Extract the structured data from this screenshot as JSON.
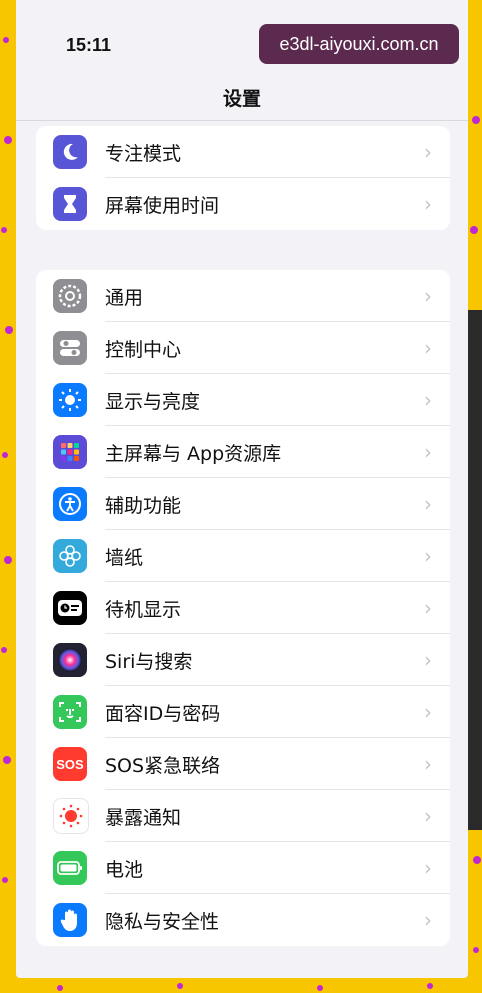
{
  "status_bar": {
    "time": "15:11"
  },
  "watermark": "e3dl-aiyouxi.com.cn",
  "nav": {
    "title": "设置"
  },
  "group1": [
    {
      "label": "专注模式",
      "icon": "moon-icon",
      "color": "#5856d6"
    },
    {
      "label": "屏幕使用时间",
      "icon": "hourglass-icon",
      "color": "#5856d6"
    }
  ],
  "group2": [
    {
      "label": "通用",
      "icon": "gear-icon",
      "color": "#8e8e93"
    },
    {
      "label": "控制中心",
      "icon": "toggles-icon",
      "color": "#8e8e93"
    },
    {
      "label": "显示与亮度",
      "icon": "sun-icon",
      "color": "#0a7aff"
    },
    {
      "label": "主屏幕与 App资源库",
      "icon": "apps-grid-icon",
      "color": "#5b4bd6"
    },
    {
      "label": "辅助功能",
      "icon": "accessibility-icon",
      "color": "#0a7aff"
    },
    {
      "label": "墙纸",
      "icon": "flower-icon",
      "color": "#34aadc"
    },
    {
      "label": "待机显示",
      "icon": "standby-icon",
      "color": "#000000"
    },
    {
      "label": "Siri与搜索",
      "icon": "siri-icon",
      "color": "#222233"
    },
    {
      "label": "面容ID与密码",
      "icon": "face-id-icon",
      "color": "#34c759"
    },
    {
      "label": "SOS紧急联络",
      "icon": "sos-icon",
      "color": "#ff3b30",
      "icon_text": "SOS"
    },
    {
      "label": "暴露通知",
      "icon": "exposure-icon",
      "color": "#ffffff"
    },
    {
      "label": "电池",
      "icon": "battery-icon",
      "color": "#34c759"
    },
    {
      "label": "隐私与安全性",
      "icon": "hand-icon",
      "color": "#0a7aff"
    }
  ]
}
